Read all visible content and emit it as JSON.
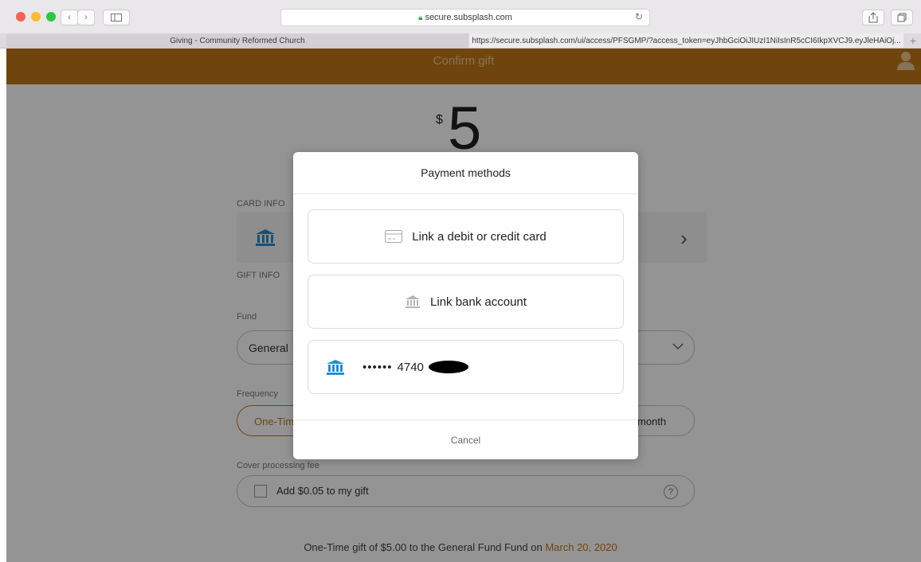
{
  "browser": {
    "address": "secure.subsplash.com",
    "tabs": [
      {
        "label": "Giving - Community Reformed Church"
      },
      {
        "label": "https://secure.subsplash.com/ui/access/PFSGMP/?access_token=eyJhbGciOiJIUzI1NiIsInR5cCI6IkpXVCJ9.eyJleHAiOj..."
      }
    ],
    "new_tab_label": "+"
  },
  "page": {
    "title": "Confirm gift",
    "amount_currency": "$",
    "amount_value": "5",
    "card_info_label": "CARD INFO",
    "gift_info_label": "GIFT INFO",
    "fund_label": "Fund",
    "fund_value": "General",
    "frequency_label": "Frequency",
    "frequency_onetime": "One-Tim",
    "frequency_month": "month",
    "fee_label": "Cover processing fee",
    "fee_option": "Add $0.05 to my gift",
    "fee_help": "?",
    "summary_prefix": "One-Time gift of $5.00 to the General Fund Fund on ",
    "summary_date": "March 20, 2020"
  },
  "modal": {
    "title": "Payment methods",
    "options": [
      {
        "label": "Link a debit or credit card",
        "icon": "credit-card-icon"
      },
      {
        "label": "Link bank account",
        "icon": "bank-icon"
      }
    ],
    "saved_method": {
      "masked": "••••••",
      "last4": "4740",
      "icon": "bank-icon"
    },
    "cancel": "Cancel"
  },
  "colors": {
    "brand": "#c27818",
    "bank_blue": "#1f8fd6"
  }
}
